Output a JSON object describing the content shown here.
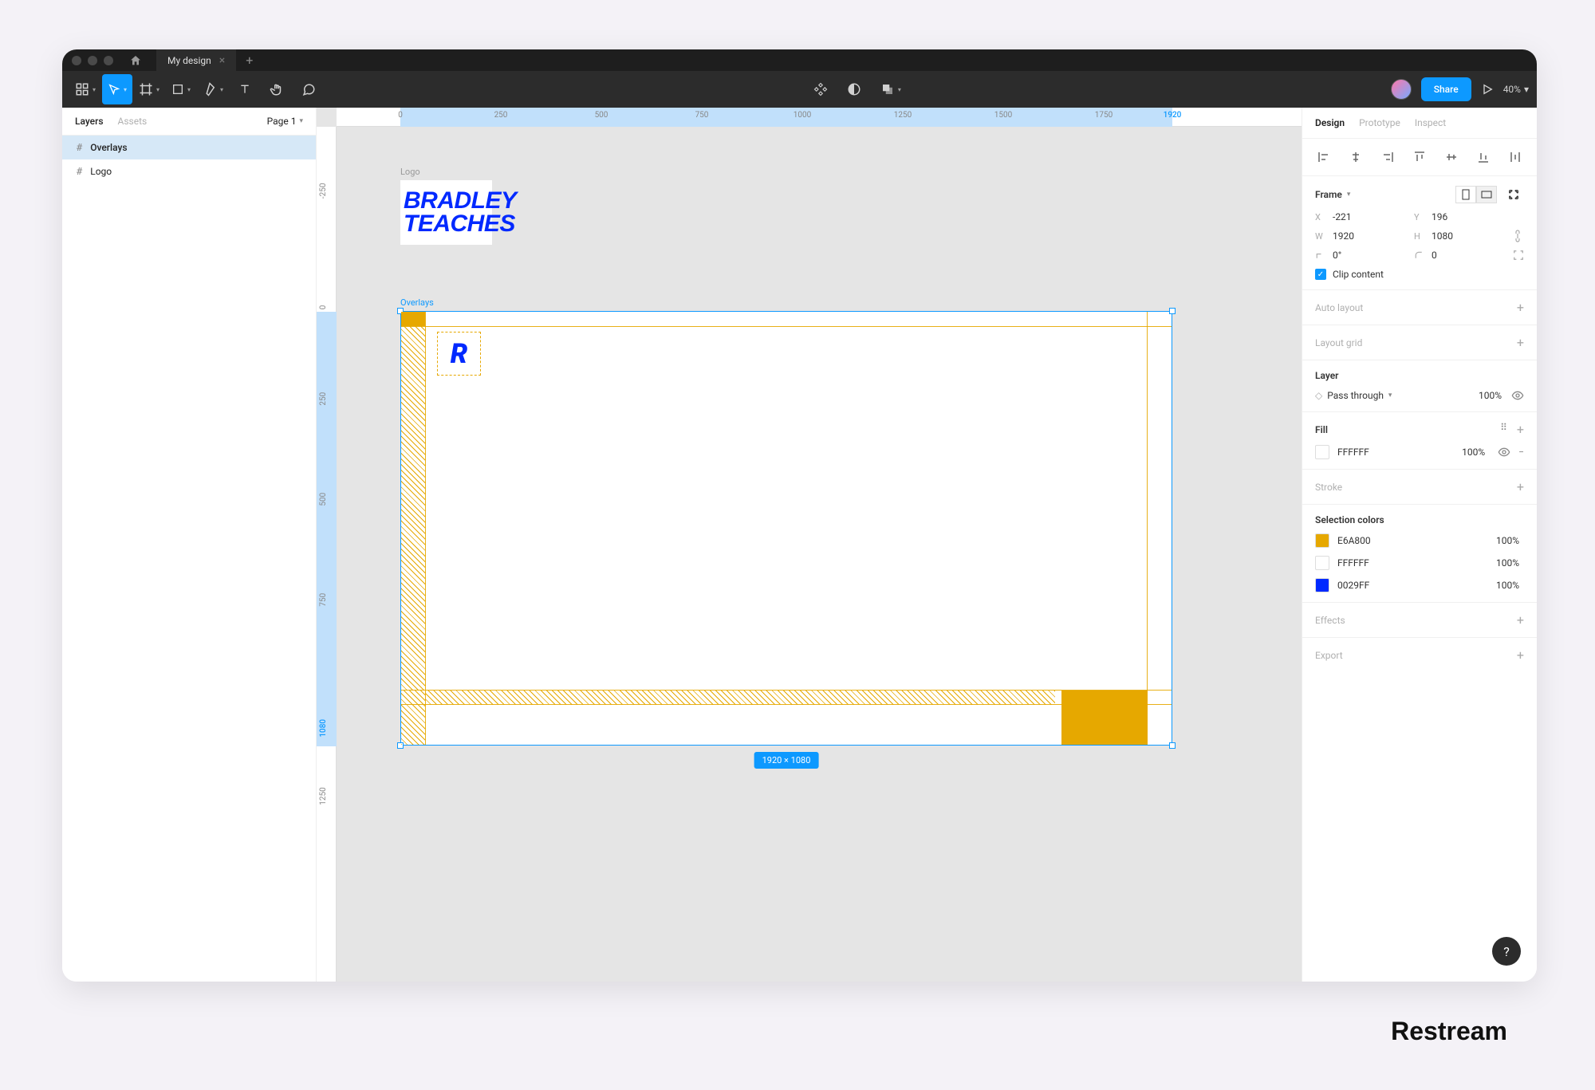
{
  "titlebar": {
    "tab_name": "My design"
  },
  "toolbar": {
    "share_label": "Share",
    "zoom": "40%"
  },
  "left_panel": {
    "tab_layers": "Layers",
    "tab_assets": "Assets",
    "page_selector": "Page 1",
    "items": [
      {
        "name": "Overlays",
        "selected": true
      },
      {
        "name": "Logo",
        "selected": false
      }
    ]
  },
  "canvas": {
    "ruler_h": [
      "0",
      "250",
      "500",
      "750",
      "1000",
      "1250",
      "1500",
      "1750",
      "1920"
    ],
    "ruler_v": [
      "-250",
      "0",
      "250",
      "500",
      "750",
      "1080",
      "1250"
    ],
    "logo_label": "Logo",
    "logo_line1": "BRADLEY",
    "logo_line2": "TEACHES",
    "overlays_label": "Overlays",
    "r_letter": "R",
    "dimensions_badge": "1920 × 1080"
  },
  "right_panel": {
    "tab_design": "Design",
    "tab_prototype": "Prototype",
    "tab_inspect": "Inspect",
    "frame_label": "Frame",
    "x": "-221",
    "y": "196",
    "w": "1920",
    "h": "1080",
    "rotation": "0°",
    "radius": "0",
    "clip_content": "Clip content",
    "auto_layout": "Auto layout",
    "layout_grid": "Layout grid",
    "layer_label": "Layer",
    "blend_mode": "Pass through",
    "layer_opacity": "100%",
    "fill_label": "Fill",
    "fill_color": "FFFFFF",
    "fill_opacity": "100%",
    "stroke_label": "Stroke",
    "selection_colors_label": "Selection colors",
    "selection_colors": [
      {
        "hex": "E6A800",
        "pct": "100%",
        "swatch": "#e6a800"
      },
      {
        "hex": "FFFFFF",
        "pct": "100%",
        "swatch": "#ffffff"
      },
      {
        "hex": "0029FF",
        "pct": "100%",
        "swatch": "#0029ff"
      }
    ],
    "effects_label": "Effects",
    "export_label": "Export"
  },
  "brand": "Restream",
  "help": "?"
}
